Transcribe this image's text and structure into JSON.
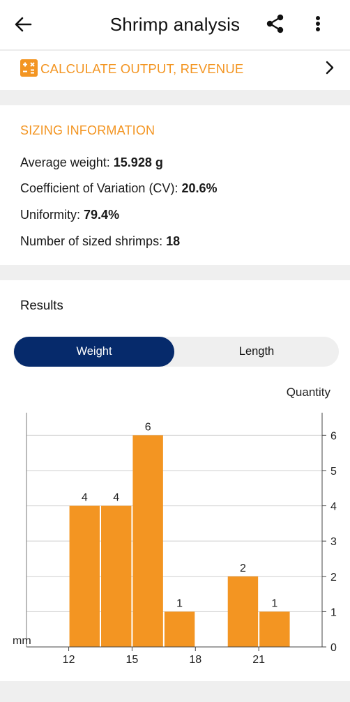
{
  "appbar": {
    "title": "Shrimp analysis",
    "back_icon": "arrow-left-icon",
    "share_icon": "share-icon",
    "more_icon": "more-vert-icon"
  },
  "calculate": {
    "label": "CALCULATE OUTPUT, REVENUE",
    "icon": "calculator-icon",
    "chevron_icon": "chevron-right-icon",
    "color": "#f39522"
  },
  "sizing": {
    "heading": "SIZING INFORMATION",
    "average_weight_label": "Average weight:",
    "average_weight_value": "15.928 g",
    "cv_label": "Coefficient of Variation (CV):",
    "cv_value": "20.6%",
    "uniformity_label": "Uniformity:",
    "uniformity_value": "79.4%",
    "count_label": "Number of sized shrimps:",
    "count_value": "18"
  },
  "results": {
    "heading": "Results",
    "tabs": [
      {
        "label": "Weight",
        "selected": true
      },
      {
        "label": "Length",
        "selected": false
      }
    ]
  },
  "colors": {
    "accent": "#f39522",
    "primary": "#062a6b"
  },
  "chart_data": {
    "type": "bar",
    "title": "",
    "xlabel": "mm",
    "ylabel": "Quantity",
    "x_ticks": [
      "12",
      "15",
      "18",
      "21"
    ],
    "xlim": [
      10,
      24
    ],
    "ylim": [
      0,
      6.6
    ],
    "y_ticks": [
      "0",
      "1",
      "2",
      "3",
      "4",
      "5",
      "6"
    ],
    "bins": [
      {
        "start": 12,
        "end": 13.5,
        "value": 4
      },
      {
        "start": 13.5,
        "end": 15,
        "value": 4
      },
      {
        "start": 15,
        "end": 16.5,
        "value": 6
      },
      {
        "start": 16.5,
        "end": 18,
        "value": 1
      },
      {
        "start": 18,
        "end": 19.5,
        "value": 0
      },
      {
        "start": 19.5,
        "end": 21,
        "value": 2
      },
      {
        "start": 21,
        "end": 22.5,
        "value": 1
      }
    ],
    "grid": true,
    "y_axis_side": "right",
    "bar_color": "#f39522"
  }
}
